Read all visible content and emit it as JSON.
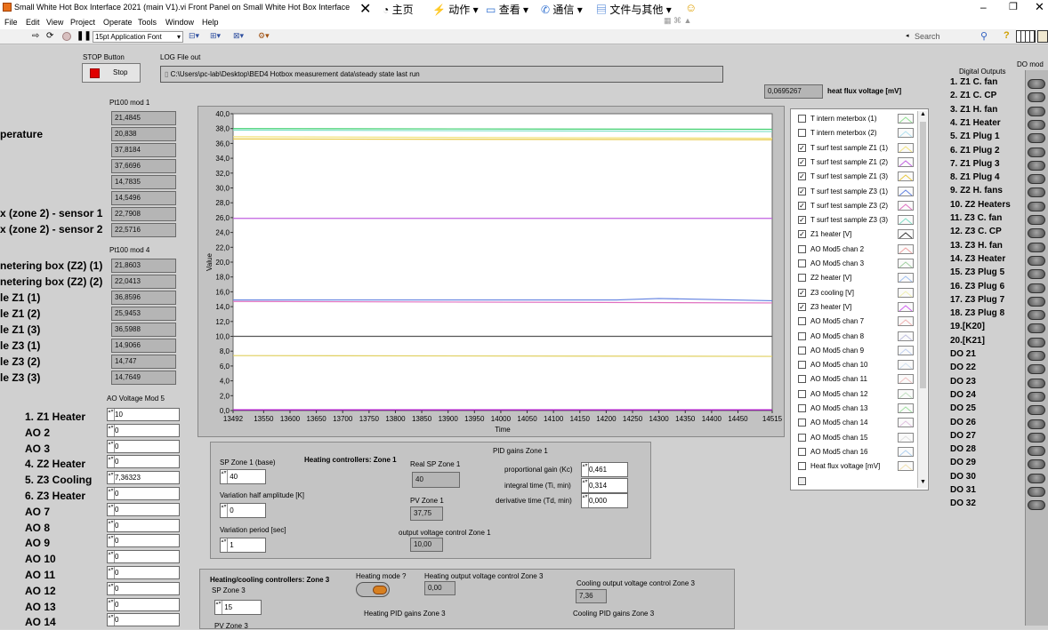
{
  "window": {
    "title": "Small White Hot Box Interface 2021 (main V1).vi Front Panel on Small White Hot Box Interface 2020.lvproj",
    "ime_toolbar": [
      "主页",
      "动作",
      "查看",
      "通信",
      "文件与其他"
    ],
    "font_select": "15pt Application Font",
    "search_placeholder": "Search"
  },
  "menu": [
    "File",
    "Edit",
    "View",
    "Project",
    "Operate",
    "Tools",
    "Window",
    "Help"
  ],
  "stop": {
    "label": "STOP Button",
    "button": "Stop"
  },
  "log": {
    "label": "LOG File out",
    "path": "C:\\Users\\pc-lab\\Desktop\\BED4 Hotbox measurement data\\steady state last run"
  },
  "heat_flux": {
    "value": "0,0695267",
    "label": "heat flux voltage [mV]"
  },
  "pt100_mod1": {
    "label": "Pt100 mod 1",
    "values": [
      "21,4845",
      "20,838",
      "37,8184",
      "37,6696",
      "14,7835",
      "14,5496",
      "22,7908",
      "22,5716"
    ]
  },
  "pt100_mod4": {
    "label": "Pt100 mod 4",
    "values": [
      "21,8603",
      "22,0413",
      "36,8596",
      "25,9453",
      "36,5988",
      "14,9066",
      "14,747",
      "14,7649"
    ]
  },
  "left_labels_mod1": [
    "perature",
    "x (zone 2) - sensor 1",
    "x (zone 2) - sensor 2"
  ],
  "left_labels_mod4": [
    "netering box (Z2) (1)",
    "netering box (Z2) (2)",
    "le Z1 (1)",
    "le Z1 (2)",
    "le Z1 (3)",
    "le Z3 (1)",
    "le Z3 (2)",
    "le Z3 (3)"
  ],
  "ao": {
    "label": "AO Voltage Mod 5",
    "names": [
      "1. Z1 Heater",
      "AO 2",
      "AO 3",
      "4. Z2 Heater",
      "5. Z3 Cooling",
      "6. Z3 Heater",
      "AO 7",
      "AO 8",
      "AO 9",
      "AO 10",
      "AO 11",
      "AO 12",
      "AO 13",
      "AO 14"
    ],
    "values": [
      "10",
      "0",
      "0",
      "0",
      "7,36323",
      "0",
      "0",
      "0",
      "0",
      "0",
      "0",
      "0",
      "0",
      "0"
    ]
  },
  "chart_data": {
    "type": "line",
    "xlabel": "Time",
    "ylabel": "Value",
    "xlim": [
      13492,
      14515
    ],
    "ylim": [
      0,
      40
    ],
    "x_ticks": [
      "13492",
      "13550",
      "13600",
      "13650",
      "13700",
      "13750",
      "13800",
      "13850",
      "13900",
      "13950",
      "14000",
      "14050",
      "14100",
      "14150",
      "14200",
      "14250",
      "14300",
      "14350",
      "14400",
      "14450",
      "14515"
    ],
    "y_ticks": [
      "0,0",
      "2,0",
      "4,0",
      "6,0",
      "8,0",
      "10,0",
      "12,0",
      "14,0",
      "16,0",
      "18,0",
      "20,0",
      "22,0",
      "24,0",
      "26,0",
      "28,0",
      "30,0",
      "32,0",
      "34,0",
      "36,0",
      "38,0",
      "40,0"
    ],
    "series": [
      {
        "name": "T surf test sample Z1 (1)",
        "color": "#f2e27a",
        "x": [
          13492,
          14515
        ],
        "y": [
          36.9,
          36.7
        ]
      },
      {
        "name": "T surf test sample Z1 (3)",
        "color": "#e8c840",
        "x": [
          13492,
          14515
        ],
        "y": [
          36.6,
          36.5
        ]
      },
      {
        "name": "T surf test sample Z3 (3)",
        "color": "#7fe0c8",
        "x": [
          13492,
          14515
        ],
        "y": [
          37.8,
          37.6
        ]
      },
      {
        "name": "Z1 heater [V]",
        "color": "#40d070",
        "x": [
          13492,
          14515
        ],
        "y": [
          38.0,
          37.9
        ]
      },
      {
        "name": "T surf test sample Z1 (2)",
        "color": "#c060e0",
        "x": [
          13492,
          14515
        ],
        "y": [
          25.9,
          25.9
        ]
      },
      {
        "name": "T surf test sample Z3 (1)",
        "color": "#6080e0",
        "x": [
          13492,
          14220,
          14300,
          14515
        ],
        "y": [
          14.9,
          14.9,
          15.1,
          14.8
        ]
      },
      {
        "name": "T surf test sample Z3 (2)",
        "color": "#e070c0",
        "x": [
          13492,
          14515
        ],
        "y": [
          14.7,
          14.5
        ]
      },
      {
        "name": "Z3 cooling [V]",
        "color": "#555555",
        "x": [
          13492,
          14515
        ],
        "y": [
          10.0,
          10.0
        ]
      },
      {
        "name": "Z3 heater [V]",
        "color": "#e0d060",
        "x": [
          13492,
          14515
        ],
        "y": [
          7.4,
          7.3
        ]
      },
      {
        "name": "AO Mod5 chan 2",
        "color": "#b000d0",
        "x": [
          13492,
          14515
        ],
        "y": [
          0.1,
          0.1
        ]
      }
    ]
  },
  "legend": {
    "items": [
      {
        "label": "T intern meterbox (1)",
        "checked": false,
        "color": "#90e090"
      },
      {
        "label": "T intern meterbox (2)",
        "checked": false,
        "color": "#b0e0f0"
      },
      {
        "label": "T surf test sample Z1 (1)",
        "checked": true,
        "color": "#f2e27a"
      },
      {
        "label": "T surf test sample Z1 (2)",
        "checked": true,
        "color": "#c060e0"
      },
      {
        "label": "T surf test sample Z1 (3)",
        "checked": true,
        "color": "#e8c840"
      },
      {
        "label": "T surf test sample Z3 (1)",
        "checked": true,
        "color": "#6080e0"
      },
      {
        "label": "T surf test sample Z3 (2)",
        "checked": true,
        "color": "#e070c0"
      },
      {
        "label": "T surf test sample Z3 (3)",
        "checked": true,
        "color": "#7fe0c8"
      },
      {
        "label": "Z1 heater [V]",
        "checked": true,
        "color": "#333333"
      },
      {
        "label": "AO Mod5 chan 2",
        "checked": false,
        "color": "#f0a0a0"
      },
      {
        "label": "AO Mod5 chan 3",
        "checked": false,
        "color": "#a0d0a0"
      },
      {
        "label": "Z2 heater [V]",
        "checked": false,
        "color": "#a0c0f0"
      },
      {
        "label": "Z3 cooling [V]",
        "checked": true,
        "color": "#f0f0b0"
      },
      {
        "label": "Z3 heater [V]",
        "checked": true,
        "color": "#d060f0"
      },
      {
        "label": "AO Mod5 chan 7",
        "checked": false,
        "color": "#f0b0b0"
      },
      {
        "label": "AO Mod5 chan 8",
        "checked": false,
        "color": "#c0c0e0"
      },
      {
        "label": "AO Mod5 chan 9",
        "checked": false,
        "color": "#c0d0f0"
      },
      {
        "label": "AO Mod5 chan 10",
        "checked": false,
        "color": "#d0e0f0"
      },
      {
        "label": "AO Mod5 chan 11",
        "checked": false,
        "color": "#f0c0c0"
      },
      {
        "label": "AO Mod5 chan 12",
        "checked": false,
        "color": "#c0e0c0"
      },
      {
        "label": "AO Mod5 chan 13",
        "checked": false,
        "color": "#a0e0a0"
      },
      {
        "label": "AO Mod5 chan 14",
        "checked": false,
        "color": "#e0c0e0"
      },
      {
        "label": "AO Mod5 chan 15",
        "checked": false,
        "color": "#e0e0e0"
      },
      {
        "label": "AO Mod5 chan 16",
        "checked": false,
        "color": "#b0d0f0"
      },
      {
        "label": "Heat flux voltage [mV]",
        "checked": false,
        "color": "#f0e0b0"
      }
    ]
  },
  "zone1": {
    "title": "Heating controllers: Zone 1",
    "sp_label": "SP Zone 1 (base)",
    "sp_value": "40",
    "var_amp_label": "Variation half amplitude [K]",
    "var_amp_value": "0",
    "var_period_label": "Variation period [sec]",
    "var_period_value": "1",
    "real_sp_label": "Real SP Zone 1",
    "real_sp_value": "40",
    "pv_label": "PV Zone 1",
    "pv_value": "37,75",
    "out_label": "output voltage control Zone 1",
    "out_value": "10,00",
    "pid_label": "PID gains Zone 1",
    "kc_label": "proportional gain (Kc)",
    "kc_value": "0,461",
    "ti_label": "integral time (Ti, min)",
    "ti_value": "0,314",
    "td_label": "derivative time (Td, min)",
    "td_value": "0,000"
  },
  "zone3": {
    "title": "Heating/cooling controllers: Zone 3",
    "sp_label": "SP Zone 3",
    "sp_value": "15",
    "mode_label": "Heating mode ?",
    "heat_out_label": "Heating output voltage control Zone 3",
    "heat_out_value": "0,00",
    "cool_out_label": "Cooling output voltage control Zone 3",
    "cool_out_value": "7,36",
    "heat_pid_label": "Heating PID gains Zone 3",
    "cool_pid_label": "Cooling PID gains Zone 3",
    "pv_label": "PV Zone 3"
  },
  "digital_outputs": {
    "label": "Digital Outputs",
    "mod_label": "DO mod",
    "items": [
      "1. Z1 C. fan",
      "2. Z1 C. CP",
      "3. Z1 H. fan",
      "4. Z1 Heater",
      "5. Z1 Plug 1",
      "6. Z1 Plug 2",
      "7. Z1 Plug 3",
      "8. Z1 Plug 4",
      "9. Z2 H. fans",
      "10. Z2 Heaters",
      "11. Z3 C. fan",
      "12. Z3 C. CP",
      "13. Z3 H. fan",
      "14. Z3 Heater",
      "15. Z3 Plug 5",
      "16. Z3 Plug 6",
      "17. Z3 Plug 7",
      "18. Z3 Plug 8",
      "19.[K20]",
      "20.[K21]",
      "DO 21",
      "DO 22",
      "DO 23",
      "DO 24",
      "DO 25",
      "DO 26",
      "DO 27",
      "DO 28",
      "DO 29",
      "DO 30",
      "DO 31",
      "DO 32"
    ]
  }
}
